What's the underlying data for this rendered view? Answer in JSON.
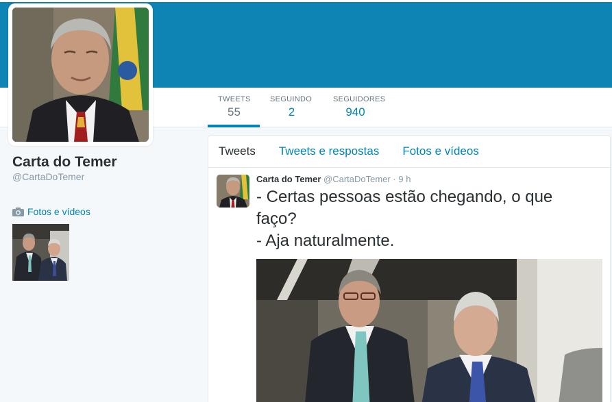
{
  "profile": {
    "name": "Carta do Temer",
    "handle": "@CartaDoTemer",
    "photos_label": "Fotos e vídeos"
  },
  "stats": [
    {
      "label": "TWEETS",
      "value": "55"
    },
    {
      "label": "SEGUINDO",
      "value": "2"
    },
    {
      "label": "SEGUIDORES",
      "value": "940"
    }
  ],
  "tabs": [
    "Tweets",
    "Tweets e respostas",
    "Fotos e vídeos"
  ],
  "tweet": {
    "name": "Carta do Temer",
    "handle": "@CartaDoTemer",
    "separator": "·",
    "time": "9 h",
    "lines": [
      "- Certas pessoas estão chegando, o que",
      "faço?",
      "- Aja naturalmente."
    ]
  },
  "colors": {
    "banner": "#0e84b4",
    "link": "#0084b4",
    "text": "#292f33",
    "muted": "#8899a6",
    "background": "#f5f8fa"
  },
  "icons": [
    "camera-icon"
  ]
}
